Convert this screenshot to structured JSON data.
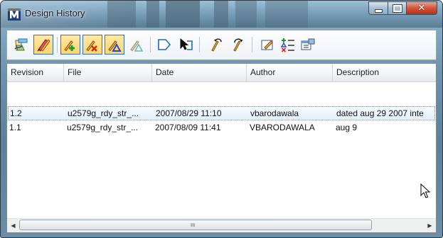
{
  "window": {
    "title": "Design History"
  },
  "caption": {
    "minimize": "–",
    "maximize": "☐",
    "close": "✕"
  },
  "toolbar": {
    "buttons": [
      "open-history-icon",
      "annotate-icon",
      "add-element-icon",
      "delete-element-icon",
      "modify-element-icon",
      "show-changes-icon",
      "select-icon",
      "select-element-icon",
      "undo-icon",
      "redo-icon",
      "edit-description-icon",
      "list-changes-icon",
      "properties-icon"
    ]
  },
  "table": {
    "columns": [
      "Revision",
      "File",
      "Date",
      "Author",
      "Description"
    ],
    "rows": [
      {
        "revision": "1.2",
        "file": "u2579g_rdy_str_...",
        "date": "2007/08/29 11:10",
        "author": "vbarodawala",
        "description": "dated aug 29 2007 inte",
        "selected": true
      },
      {
        "revision": "1.1",
        "file": "u2579g_rdy_str_...",
        "date": "2007/08/09 11:41",
        "author": "VBARODAWALA",
        "description": "aug 9",
        "selected": false
      }
    ]
  },
  "scrollbar": {
    "left": "◀",
    "right": "▶",
    "grip": "III"
  },
  "colors": {
    "accent": "#3271b8",
    "pressed_fill": "#ffd46a",
    "selected_row": "#e3effb"
  }
}
